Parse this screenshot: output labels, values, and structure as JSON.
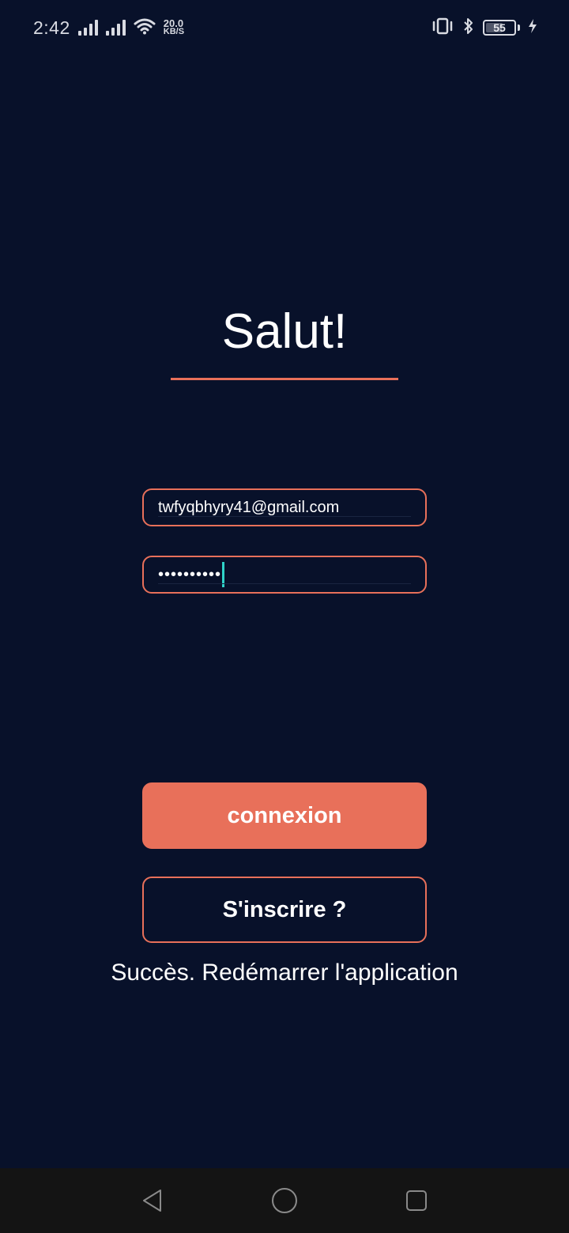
{
  "status_bar": {
    "time": "2:42",
    "network_speed_value": "20.0",
    "network_speed_unit": "KB/S",
    "battery_level": "55"
  },
  "login": {
    "title": "Salut!",
    "email_value": "twfyqbhyry41@gmail.com",
    "password_mask": "••••••••••",
    "connexion_label": "connexion",
    "signup_label": "S'inscrire ?",
    "status_message": "Succès. Redémarrer l'application"
  },
  "colors": {
    "background": "#08112a",
    "accent": "#e8705a",
    "caret": "#2fd3c9",
    "nav_bar": "#141414"
  },
  "icons": {
    "nav_back": "triangle-left",
    "nav_home": "circle",
    "nav_recents": "square"
  }
}
